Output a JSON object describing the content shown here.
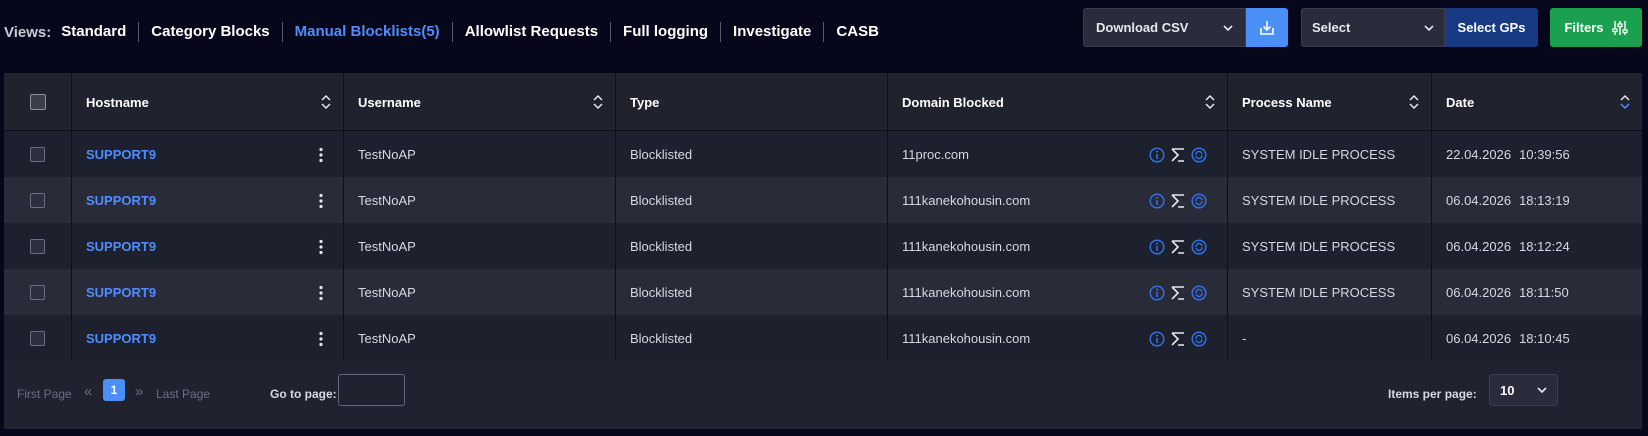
{
  "views": {
    "label": "Views:",
    "tabs": [
      {
        "label": "Standard",
        "active": false
      },
      {
        "label": "Category Blocks",
        "active": false
      },
      {
        "label": "Manual Blocklists(5)",
        "active": true
      },
      {
        "label": "Allowlist Requests",
        "active": false
      },
      {
        "label": "Full logging",
        "active": false
      },
      {
        "label": "Investigate",
        "active": false
      },
      {
        "label": "CASB",
        "active": false
      }
    ]
  },
  "toolbar": {
    "download_select": "Download CSV",
    "gp_select": "Select",
    "gp_button": "Select GPs",
    "filters_button": "Filters"
  },
  "table": {
    "columns": [
      "Hostname",
      "Username",
      "Type",
      "Domain Blocked",
      "Process Name",
      "Date"
    ],
    "rows": [
      {
        "hostname": "SUPPORT9",
        "username": "TestNoAP",
        "type": "Blocklisted",
        "domain": "11proc.com",
        "process": "SYSTEM IDLE PROCESS",
        "date": "22.04.2026",
        "time": "10:39:56"
      },
      {
        "hostname": "SUPPORT9",
        "username": "TestNoAP",
        "type": "Blocklisted",
        "domain": "111kanekohousin.com",
        "process": "SYSTEM IDLE PROCESS",
        "date": "06.04.2026",
        "time": "18:13:19"
      },
      {
        "hostname": "SUPPORT9",
        "username": "TestNoAP",
        "type": "Blocklisted",
        "domain": "111kanekohousin.com",
        "process": "SYSTEM IDLE PROCESS",
        "date": "06.04.2026",
        "time": "18:12:24"
      },
      {
        "hostname": "SUPPORT9",
        "username": "TestNoAP",
        "type": "Blocklisted",
        "domain": "111kanekohousin.com",
        "process": "SYSTEM IDLE PROCESS",
        "date": "06.04.2026",
        "time": "18:11:50"
      },
      {
        "hostname": "SUPPORT9",
        "username": "TestNoAP",
        "type": "Blocklisted",
        "domain": "111kanekohousin.com",
        "process": "-",
        "date": "06.04.2026",
        "time": "18:10:45"
      }
    ]
  },
  "pagination": {
    "first": "First Page",
    "current": "1",
    "last": "Last Page",
    "goto_label": "Go to page:",
    "goto_value": "",
    "items_label": "Items per page:",
    "items_value": "10"
  },
  "colors": {
    "accent": "#4f8dff",
    "filters": "#1aa04f",
    "gp_button": "#173a82"
  }
}
